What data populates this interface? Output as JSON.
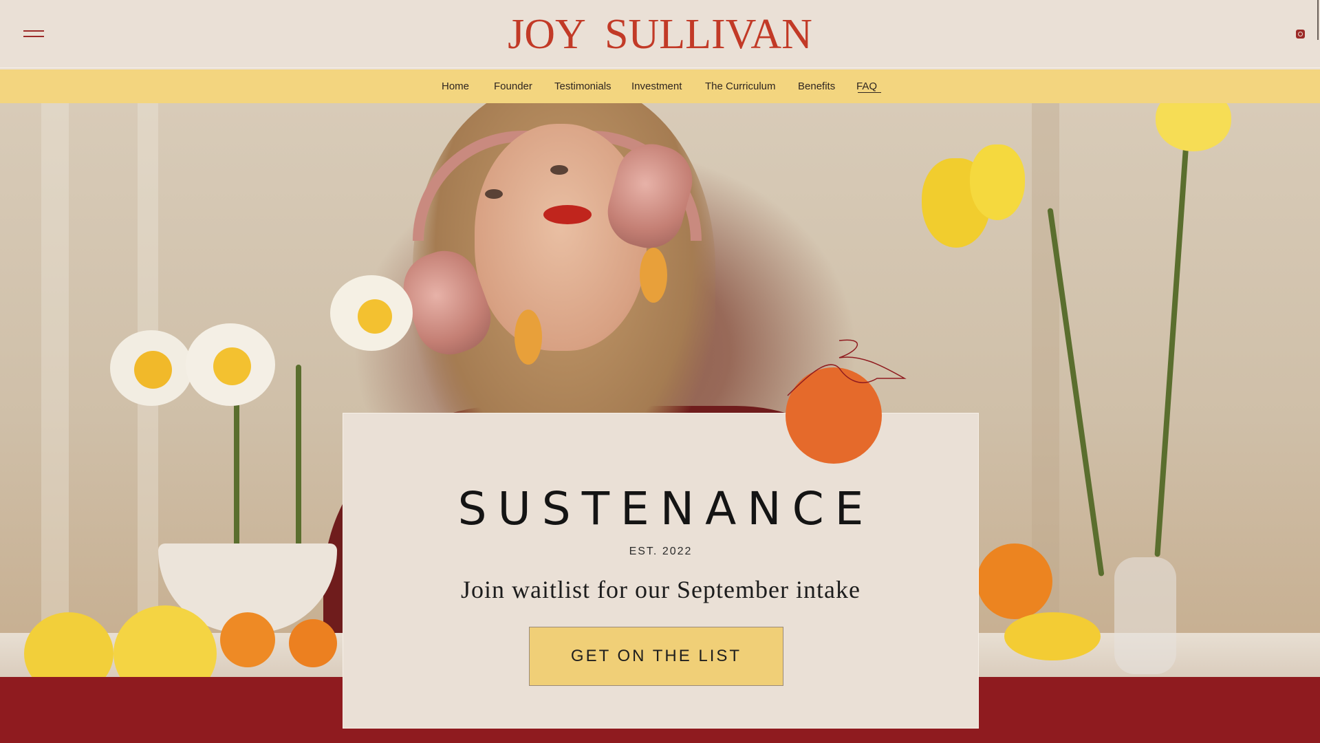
{
  "header": {
    "logo": "JOY SULLIVAN",
    "menu_icon": "hamburger-menu-icon",
    "social_icon": "instagram-icon"
  },
  "nav": {
    "items": [
      {
        "label": "Home"
      },
      {
        "label": "Founder"
      },
      {
        "label": "Testimonials"
      },
      {
        "label": "Investment"
      },
      {
        "label": "The Curriculum"
      },
      {
        "label": "Benefits"
      },
      {
        "label": "FAQ"
      }
    ]
  },
  "hero": {
    "card": {
      "title": "SUSTENANCE",
      "established": "EST. 2022",
      "subtitle": "Join waitlist for our September intake",
      "cta_label": "GET ON THE LIST"
    }
  },
  "colors": {
    "accent": "#c23a27",
    "nav_bg": "#f3d57f",
    "band": "#8f1b1f",
    "cta": "#f0cf77",
    "dot": "#e56a2b"
  }
}
